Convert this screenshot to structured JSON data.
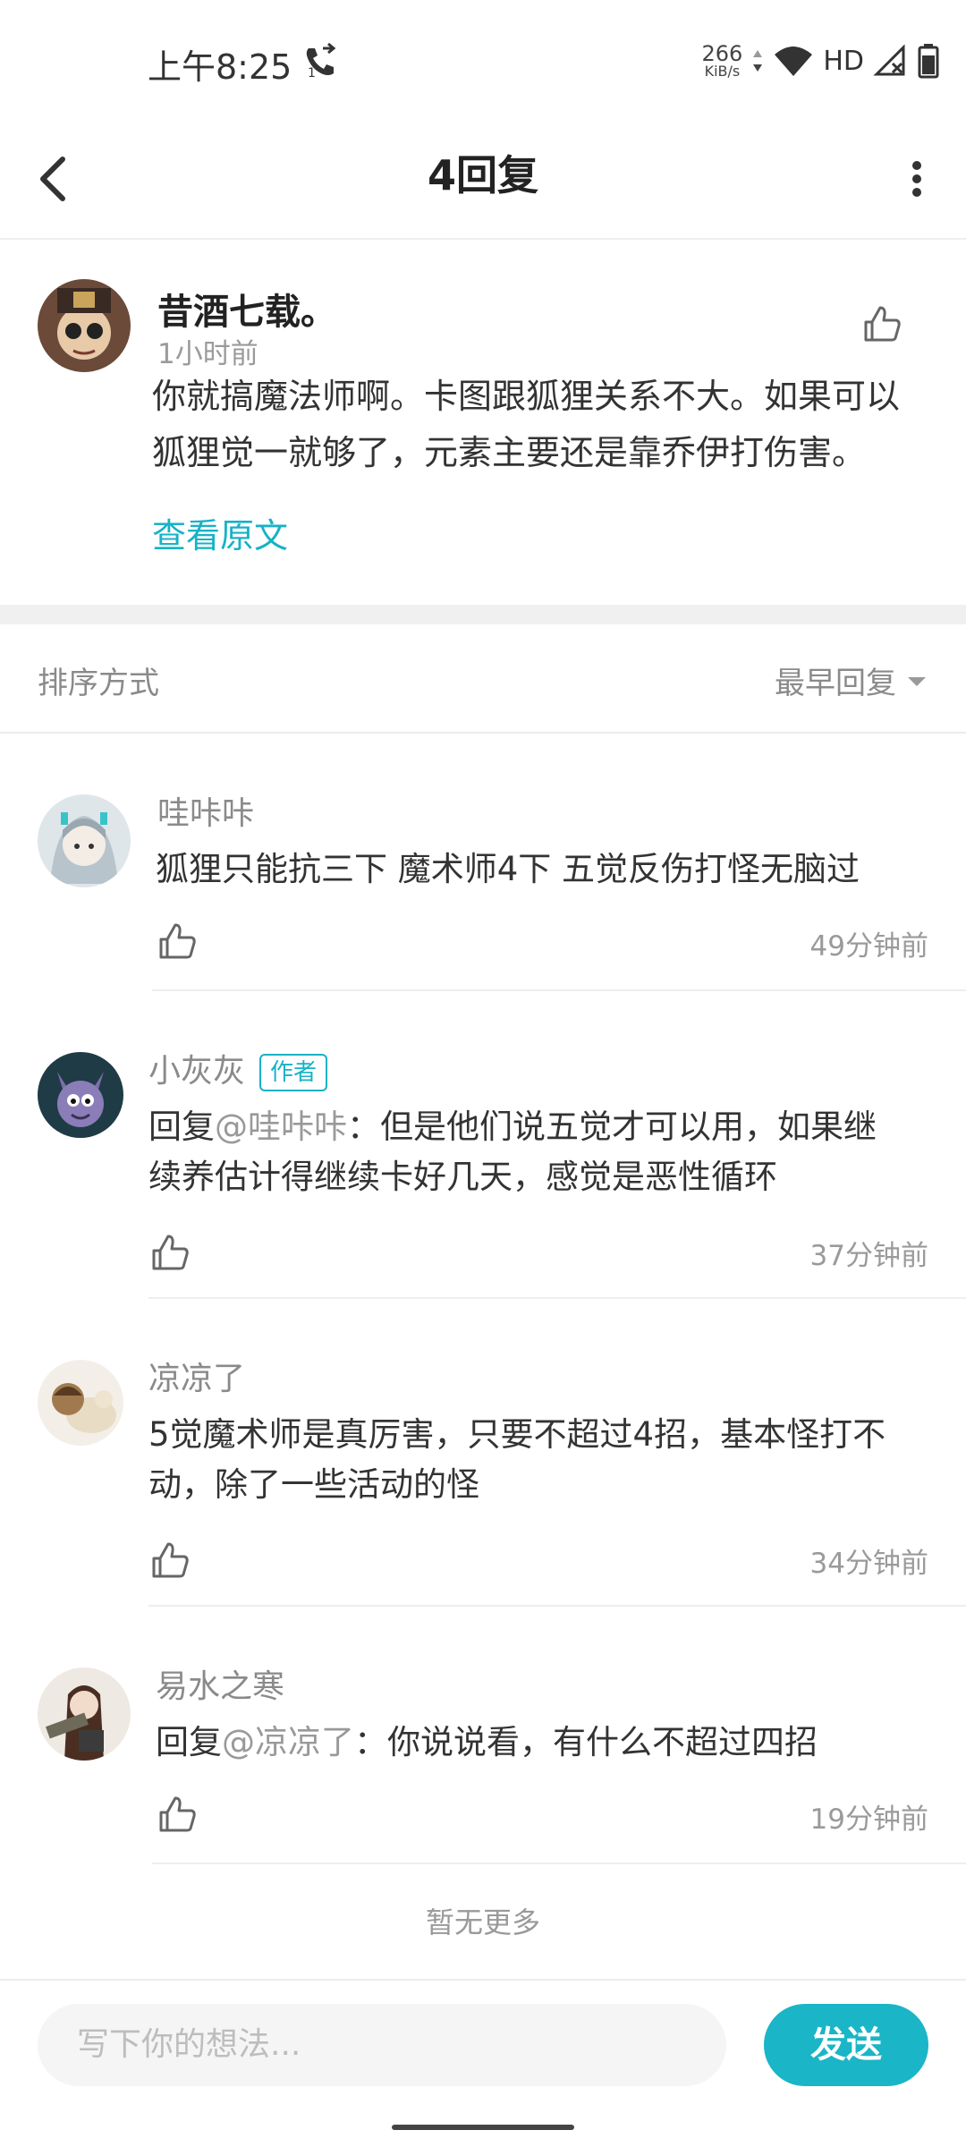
{
  "status_bar": {
    "time": "上午8:25",
    "call_badge": "1",
    "net_speed_value": "266",
    "net_speed_unit": "KiB/s",
    "hd_label": "HD"
  },
  "header": {
    "title": "4回复"
  },
  "original_post": {
    "author": "昔酒七载。",
    "time": "1小时前",
    "text_line1": "你就搞魔法师啊。卡图跟狐狸关系不大。如果可以",
    "text_line2": "狐狸觉一就够了，元素主要还是靠乔伊打伤害。",
    "view_original": "查看原文"
  },
  "sort": {
    "label": "排序方式",
    "selected": "最早回复"
  },
  "replies": [
    {
      "author": "哇咔咔",
      "line1": "狐狸只能抗三下 魔术师4下 五觉反伤打怪无脑过",
      "time": "49分钟前"
    },
    {
      "author": "小灰灰",
      "badge": "作者",
      "reply_prefix": "回复",
      "mention": "@哇咔咔",
      "line1_rest": "：但是他们说五觉才可以用，如果继",
      "line2": "续养估计得继续卡好几天，感觉是恶性循环",
      "time": "37分钟前"
    },
    {
      "author": "凉凉了",
      "line1": "5觉魔术师是真厉害，只要不超过4招，基本怪打不",
      "line2": "动，除了一些活动的怪",
      "time": "34分钟前"
    },
    {
      "author": "易水之寒",
      "reply_prefix": "回复",
      "mention": "@凉凉了",
      "line1_rest": "：你说说看，有什么不超过四招",
      "time": "19分钟前"
    }
  ],
  "footer_note": "暂无更多",
  "input": {
    "placeholder": "写下你的想法...",
    "send_label": "发送"
  },
  "colors": {
    "accent": "#1ab5c7",
    "link": "#17b2c6",
    "muted": "#9a9a9a"
  },
  "icons": [
    "back-arrow-icon",
    "more-vertical-icon",
    "thumbs-up-icon",
    "dropdown-arrow-icon",
    "phone-forward-icon",
    "wifi-icon",
    "signal-icon",
    "battery-icon"
  ]
}
